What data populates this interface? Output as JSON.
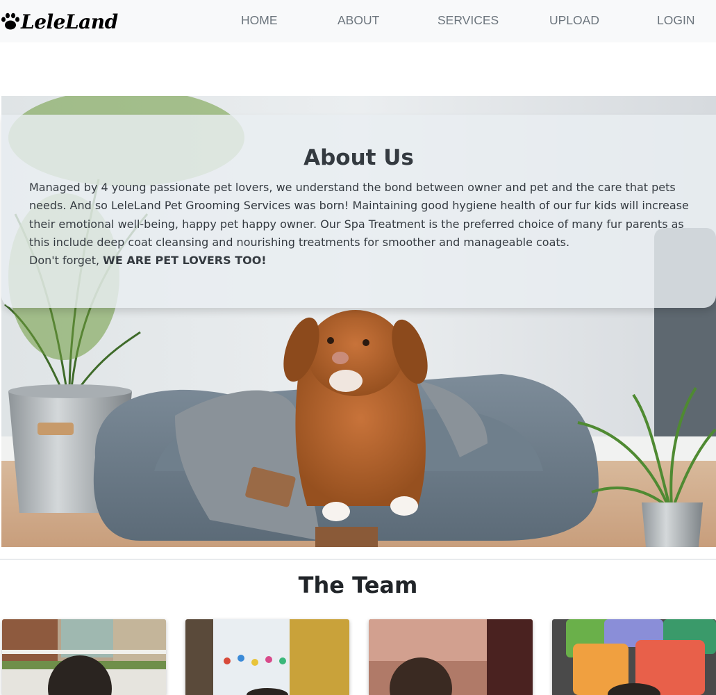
{
  "navbar": {
    "brand": "LeleLand",
    "links": [
      "HOME",
      "ABOUT",
      "SERVICES",
      "UPLOAD",
      "LOGIN"
    ]
  },
  "about": {
    "title": "About Us",
    "paragraph": "Managed by 4 young passionate pet lovers, we understand the bond between owner and pet and the care that pets needs. And so LeleLand Pet Grooming Services was born! Maintaining good hygiene health of our fur kids will increase their emotional well-being, happy pet happy owner. Our Spa Treatment is the preferred choice of many fur parents as this include deep coat cleansing and nourishing treatments for smoother and manageable coats.",
    "closing_prefix": "Don't forget, ",
    "closing_emphasis": "WE ARE PET LOVERS TOO!"
  },
  "team": {
    "title": "The Team",
    "members": 4
  },
  "icons": {
    "brand_icon": "paw-icon"
  }
}
